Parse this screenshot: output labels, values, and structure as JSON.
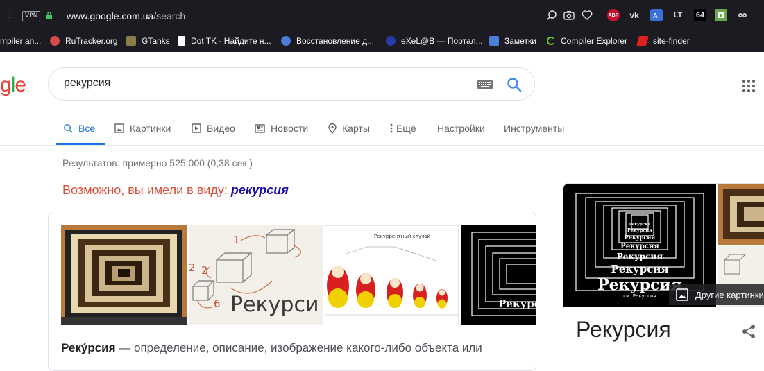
{
  "browser": {
    "vpn_badge": "VPN",
    "url_host": "www.google.com.ua",
    "url_path": "/search",
    "bookmarks": [
      {
        "label": "mpiler an...",
        "color": "#4a90d9"
      },
      {
        "label": "RuTracker.org",
        "color": "#d64a4a"
      },
      {
        "label": "GTanks",
        "color": "#8a7d4a"
      },
      {
        "label": "Dot TK - Найдите н...",
        "color": "#ffffff"
      },
      {
        "label": "Восстановление д...",
        "color": "#4a7fd9"
      },
      {
        "label": "eXeL@B — Портал...",
        "color": "#2a3aa8"
      },
      {
        "label": "Заметки",
        "color": "#4a7fd9"
      },
      {
        "label": "Compiler Explorer",
        "color": "#67c52a"
      },
      {
        "label": "site-finder",
        "color": "#e02020"
      }
    ],
    "toolbar_icons": [
      "zoom-icon",
      "screenshot-icon",
      "heart-icon",
      "adblock-icon",
      "vk-icon",
      "translate-icon",
      "lt-icon",
      "64-icon",
      "extension-icon",
      "owl-icon"
    ],
    "toolbar_texts": {
      "abp": "ABP",
      "vk": "vk",
      "lt": "LT",
      "n64": "64"
    }
  },
  "google": {
    "logo_tail": "gle",
    "query": "рекурсия",
    "tabs": [
      {
        "label": "Все",
        "icon": "search-icon",
        "active": true
      },
      {
        "label": "Картинки",
        "icon": "image-icon"
      },
      {
        "label": "Видео",
        "icon": "video-icon"
      },
      {
        "label": "Новости",
        "icon": "news-icon"
      },
      {
        "label": "Карты",
        "icon": "map-pin-icon"
      },
      {
        "label": "Ещё",
        "icon": "more-vert-icon"
      },
      {
        "label": "Настройки"
      },
      {
        "label": "Инструменты"
      }
    ],
    "stats": "Результатов: примерно 525 000 (0,38 сек.) ",
    "didyoumean_prefix": "Возможно, вы имели в виду: ",
    "didyoumean_term": "рекурсия",
    "snippet_term": "Реку́рсия",
    "snippet_text": " — определение, описание, изображение какого-либо объекта или",
    "thumbs": {
      "t2_numbers": [
        "1",
        "2",
        "2",
        "6"
      ],
      "t2_word": "Рекурси",
      "t3_title": "Рекуррентный случай",
      "t4_word": "Рекурсия"
    },
    "kp": {
      "image_words": [
        "Рекурсия",
        "см. Рекурсия"
      ],
      "more_images": "Другие картинки",
      "title": "Рекурсия"
    }
  }
}
